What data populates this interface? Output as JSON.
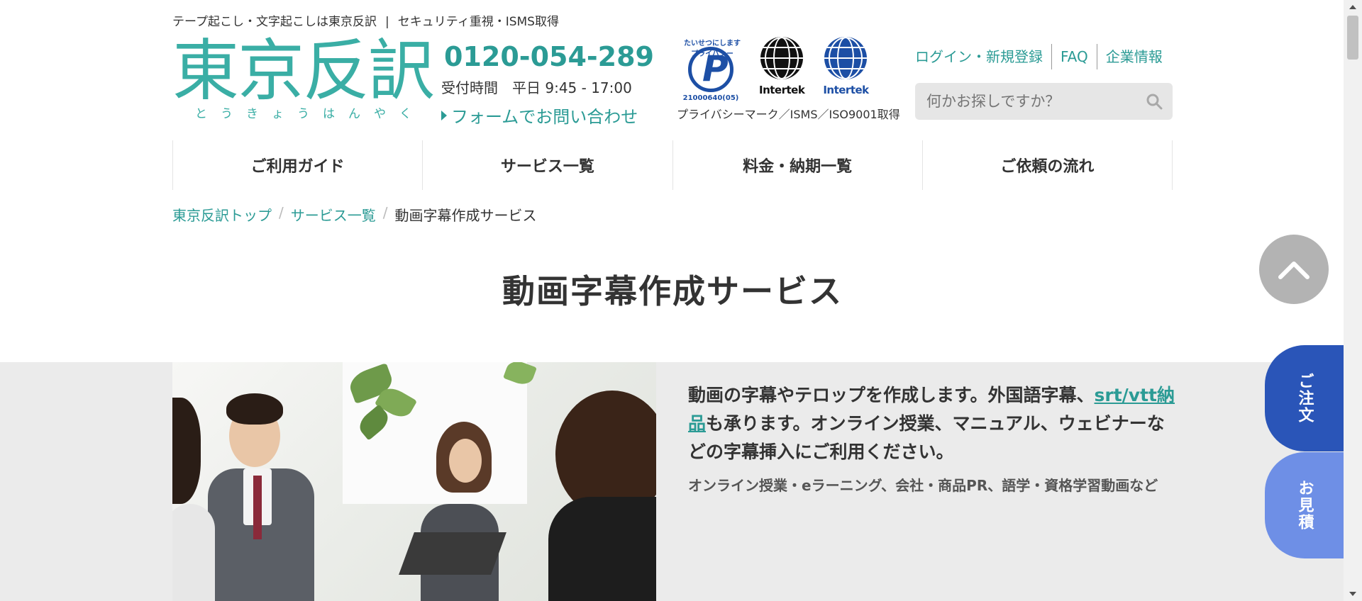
{
  "header": {
    "tagline_left": "テープ起こし・文字起こしは東京反訳",
    "tagline_sep": "|",
    "tagline_right": "セキュリティ重視・ISMS取得",
    "logo_text": "東京反訳",
    "logo_kana": "とうきょうはんやく",
    "phone": "0120-054-289",
    "hours": "受付時間　平日 9:45 - 17:00",
    "form_link": "フォームでお問い合わせ",
    "cert_pmark_arc": "たいせつにしますプライバシー",
    "cert_pmark_number": "21000640(05)",
    "cert_intertek_1": "Intertek",
    "cert_intertek_2": "Intertek",
    "cert_caption": "プライバシーマーク／ISMS／ISO9001取得",
    "links": [
      "ログイン・新規登録",
      "FAQ",
      "企業情報"
    ],
    "search_placeholder": "何かお探しですか？"
  },
  "nav": {
    "items": [
      "ご利用ガイド",
      "サービス一覧",
      "料金・納期一覧",
      "ご依頼の流れ"
    ]
  },
  "breadcrumb": {
    "items": [
      "東京反訳トップ",
      "サービス一覧"
    ],
    "separator": "/",
    "current": "動画字幕作成サービス"
  },
  "main": {
    "title": "動画字幕作成サービス",
    "lead_part1": "動画の字幕やテロップを作成します。外国語字幕、",
    "lead_link": "srt/vtt納品",
    "lead_part2": "も承ります。オンライン授業、マニュアル、ウェビナーなどの字幕挿入にご利用ください。",
    "sub": "オンライン授業・eラーニング、会社・商品PR、語学・資格学習動画など"
  },
  "floating": {
    "order": "ご注文",
    "estimate": "お見積"
  },
  "colors": {
    "brand_teal": "#3aaea5",
    "link_teal": "#2b9b95",
    "order_blue": "#2a55b8",
    "estimate_blue": "#6e8fe6",
    "band_gray": "#ebebeb"
  },
  "icons": {
    "phone": "phone-icon",
    "search": "search-icon",
    "to_top": "chevron-up-icon"
  }
}
